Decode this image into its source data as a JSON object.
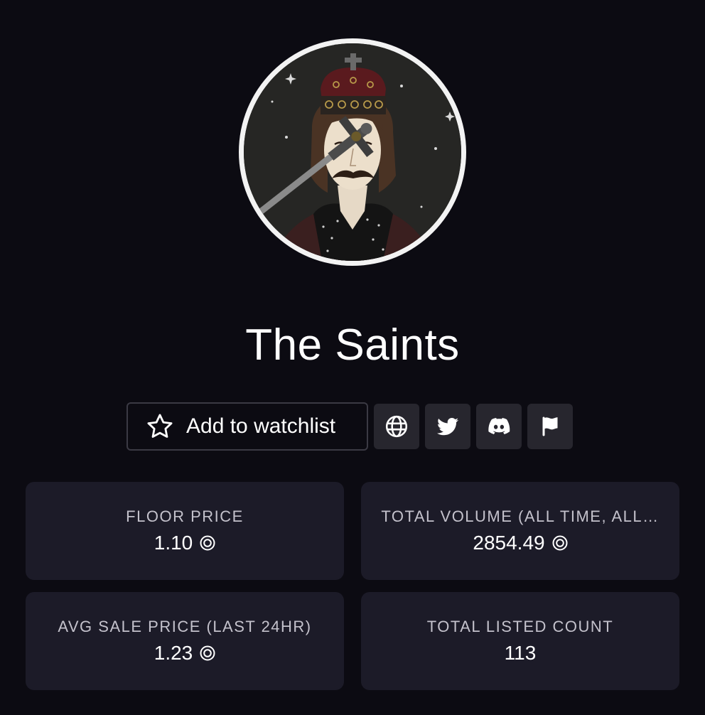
{
  "collection": {
    "title": "The Saints",
    "avatar_icon": "crowned-saint-portrait"
  },
  "actions": {
    "watchlist_label": "Add to watchlist",
    "watchlist_icon": "star-icon",
    "links": [
      {
        "icon": "globe-icon",
        "purpose": "website"
      },
      {
        "icon": "twitter-icon",
        "purpose": "twitter"
      },
      {
        "icon": "discord-icon",
        "purpose": "discord"
      },
      {
        "icon": "flag-icon",
        "purpose": "report"
      }
    ]
  },
  "stats": [
    {
      "label": "FLOOR PRICE",
      "value": "1.10",
      "currency_icon": "sol-coin-icon"
    },
    {
      "label": "TOTAL VOLUME (ALL TIME, ALL…",
      "value": "2854.49",
      "currency_icon": "sol-coin-icon"
    },
    {
      "label": "AVG SALE PRICE (LAST 24HR)",
      "value": "1.23",
      "currency_icon": "sol-coin-icon"
    },
    {
      "label": "TOTAL LISTED COUNT",
      "value": "113"
    }
  ],
  "colors": {
    "background": "#0c0b12",
    "card": "#1c1b28",
    "icon_button": "#27262e",
    "text": "#ffffff",
    "muted_text": "#c4c2cc"
  }
}
